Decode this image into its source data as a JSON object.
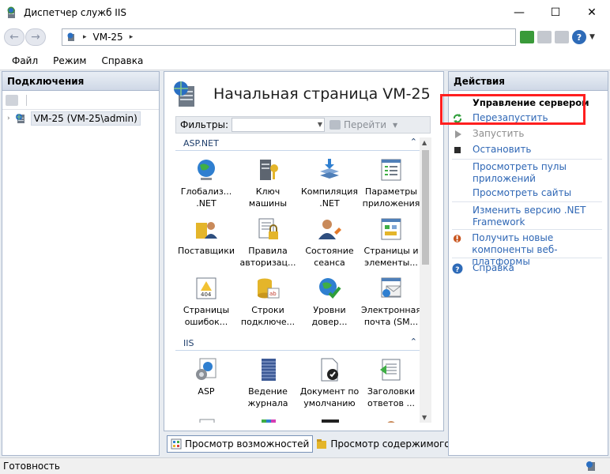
{
  "window": {
    "title": "Диспетчер служб IIS",
    "min_glyph": "—",
    "max_glyph": "☐",
    "close_glyph": "✕"
  },
  "address": {
    "back_glyph": "←",
    "forward_glyph": "→",
    "crumb": "VM-25",
    "sep_glyph": "▸"
  },
  "menu": [
    "Файл",
    "Режим",
    "Справка"
  ],
  "connections": {
    "header": "Подключения",
    "tree_expander": "›",
    "node_label": "VM-25 (VM-25\\admin)"
  },
  "center": {
    "title": "Начальная страница VM-25",
    "filter_label": "Фильтры:",
    "go_label": "Перейти",
    "groups": [
      {
        "name": "ASP.NET",
        "items": [
          {
            "label": "Глобализ...\n.NET",
            "icon": "globe-icon"
          },
          {
            "label": "Ключ\nмашины",
            "icon": "machine-key-icon"
          },
          {
            "label": "Компиляция\n.NET",
            "icon": "compilation-icon"
          },
          {
            "label": "Параметры\nприложения",
            "icon": "app-settings-icon"
          },
          {
            "label": "Поставщики",
            "icon": "providers-icon"
          },
          {
            "label": "Правила\nавторизац...",
            "icon": "authorization-rules-icon"
          },
          {
            "label": "Состояние\nсеанса",
            "icon": "session-state-icon"
          },
          {
            "label": "Страницы и\nэлементы...",
            "icon": "pages-controls-icon"
          },
          {
            "label": "Страницы\nошибок...",
            "icon": "error-pages-icon"
          },
          {
            "label": "Строки\nподключе...",
            "icon": "connection-strings-icon"
          },
          {
            "label": "Уровни\nдовер...",
            "icon": "trust-levels-icon"
          },
          {
            "label": "Электронная\nпочта (SM...",
            "icon": "smtp-email-icon"
          }
        ]
      },
      {
        "name": "IIS",
        "items": [
          {
            "label": "ASP",
            "icon": "asp-icon"
          },
          {
            "label": "Ведение\nжурнала",
            "icon": "logging-icon"
          },
          {
            "label": "Документ по\nумолчанию",
            "icon": "default-document-icon"
          },
          {
            "label": "Заголовки\nответов ...",
            "icon": "response-headers-icon"
          }
        ]
      }
    ],
    "view_tabs": [
      "Просмотр возможностей",
      "Просмотр содержимого"
    ]
  },
  "actions": {
    "header": "Действия",
    "group_title": "Управление сервером",
    "items": [
      {
        "label": "Перезапустить",
        "icon": "restart-icon",
        "enabled": true
      },
      {
        "label": "Запустить",
        "icon": "start-icon",
        "enabled": false
      },
      {
        "label": "Остановить",
        "icon": "stop-icon",
        "enabled": true
      },
      {
        "label": "Просмотреть пулы\nприложений",
        "icon": "",
        "enabled": true
      },
      {
        "label": "Просмотреть сайты",
        "icon": "",
        "enabled": true
      },
      {
        "label": "Изменить версию .NET\nFramework",
        "icon": "",
        "enabled": true
      },
      {
        "label": "Получить новые\nкомпоненты веб-платформы",
        "icon": "web-platform-icon",
        "enabled": true
      },
      {
        "label": "Справка",
        "icon": "help-icon",
        "enabled": true
      }
    ]
  },
  "status": {
    "text": "Готовность"
  },
  "colors": {
    "link": "#2f67b5",
    "highlight": "#ff1f1f",
    "panel_border": "#a9b7cc"
  }
}
